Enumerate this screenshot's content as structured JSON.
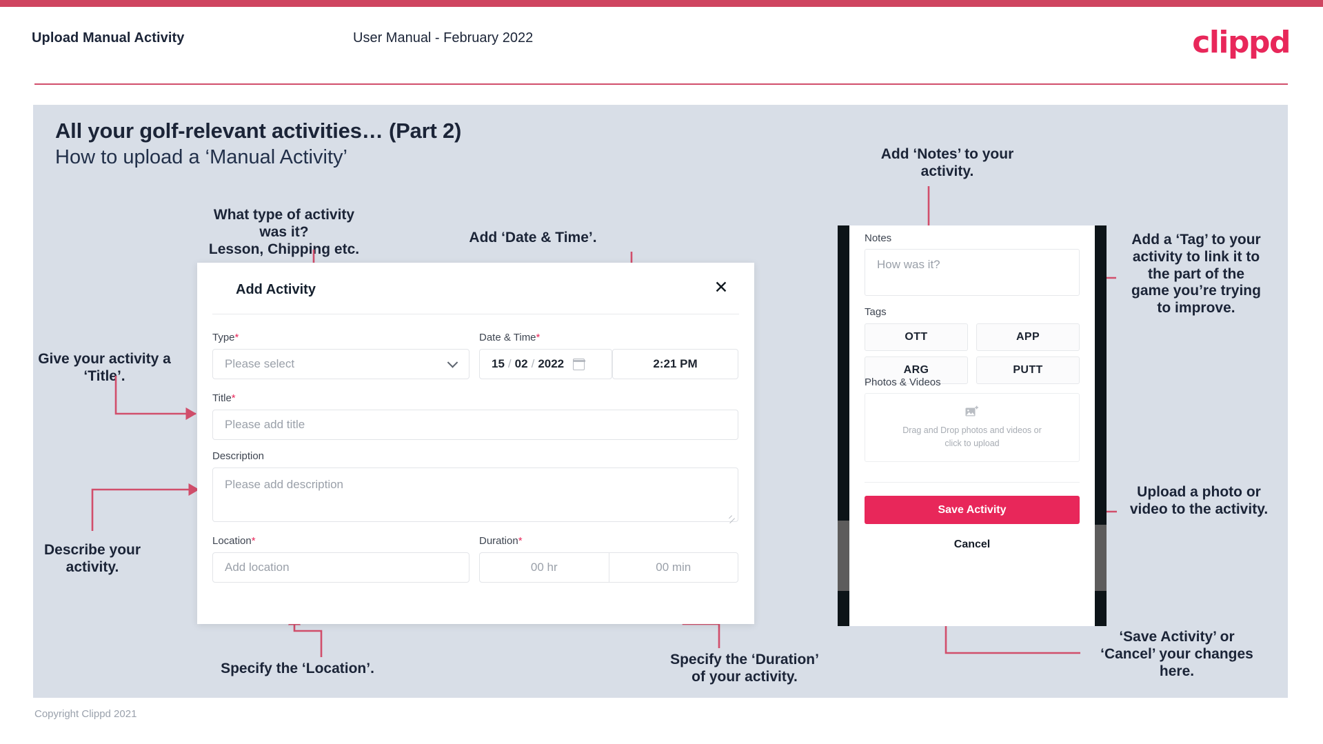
{
  "header": {
    "title": "Upload Manual Activity",
    "subtitle": "User Manual - February 2022",
    "logo": "clippd"
  },
  "slide": {
    "heading": "All your golf-relevant activities… (Part 2)",
    "subheading": "How to upload a ‘Manual Activity’",
    "copyright": "Copyright Clippd 2021"
  },
  "dialog": {
    "title": "Add Activity",
    "close_icon": "close-icon",
    "fields": {
      "type": {
        "label": "Type",
        "required": "*",
        "placeholder": "Please select"
      },
      "datetime": {
        "label": "Date & Time",
        "required": "*",
        "day": "15",
        "month": "02",
        "year": "2022",
        "sep": "/",
        "time": "2:21 PM",
        "calendar_icon": "calendar-icon"
      },
      "title": {
        "label": "Title",
        "required": "*",
        "placeholder": "Please add title"
      },
      "description": {
        "label": "Description",
        "placeholder": "Please add description"
      },
      "location": {
        "label": "Location",
        "required": "*",
        "placeholder": "Add location"
      },
      "duration": {
        "label": "Duration",
        "required": "*",
        "hours": "00 hr",
        "minutes": "00 min"
      }
    }
  },
  "phone": {
    "notes": {
      "label": "Notes",
      "placeholder": "How was it?"
    },
    "tags": {
      "label": "Tags",
      "items": [
        "OTT",
        "APP",
        "ARG",
        "PUTT"
      ]
    },
    "photos": {
      "label": "Photos & Videos",
      "icon": "add-image-icon",
      "line1": "Drag and Drop photos and videos or",
      "line2": "click to upload"
    },
    "save_label": "Save Activity",
    "cancel_label": "Cancel"
  },
  "annotations": {
    "type": "What type of activity was it?\nLesson, Chipping etc.",
    "datetime": "Add ‘Date & Time’.",
    "title": "Give your activity a\n‘Title’.",
    "description": "Describe your\nactivity.",
    "location": "Specify the ‘Location’.",
    "duration": "Specify the ‘Duration’\nof your activity.",
    "notes": "Add ‘Notes’ to your\nactivity.",
    "tags": "Add a ‘Tag’ to your\nactivity to link it to\nthe part of the\ngame you’re trying\nto improve.",
    "upload": "Upload a photo or\nvideo to the activity.",
    "save": "‘Save Activity’ or\n‘Cancel’ your changes\nhere."
  },
  "colors": {
    "brand": "#e8275a",
    "stripe": "#cf4560",
    "slide_bg": "#d8dee7",
    "arrow": "#d14e6b",
    "text_dark": "#1b2437"
  }
}
